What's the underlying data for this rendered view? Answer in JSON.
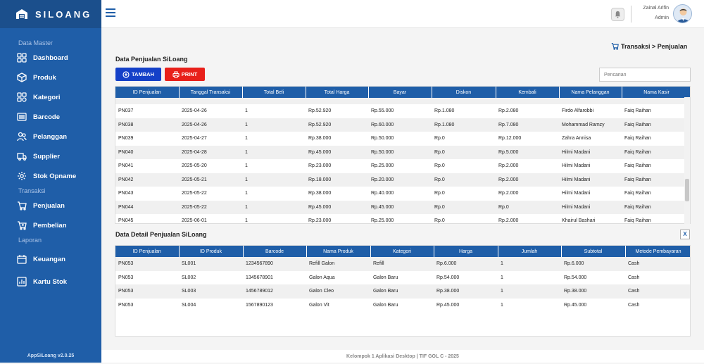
{
  "app": {
    "brand": "SILOANG",
    "version": "AppSiLoang v2.0.25"
  },
  "sidebar": {
    "sections": [
      "Data Master",
      "Transaksi",
      "Laporan"
    ],
    "items": [
      {
        "label": "Dashboard",
        "icon": "dashboard-icon"
      },
      {
        "label": "Produk",
        "icon": "box-icon"
      },
      {
        "label": "Kategori",
        "icon": "category-icon"
      },
      {
        "label": "Barcode",
        "icon": "barcode-icon"
      },
      {
        "label": "Pelanggan",
        "icon": "users-icon"
      },
      {
        "label": "Supplier",
        "icon": "truck-icon"
      },
      {
        "label": "Stok Opname",
        "icon": "gear-icon"
      },
      {
        "label": "Penjualan",
        "icon": "cart-icon"
      },
      {
        "label": "Pembelian",
        "icon": "cart-plus-icon"
      },
      {
        "label": "Keuangan",
        "icon": "calendar-icon"
      },
      {
        "label": "Kartu Stok",
        "icon": "chart-icon"
      }
    ]
  },
  "user": {
    "name": "Zainal Arifin",
    "role": "Admin"
  },
  "breadcrumb": "Transaksi > Penjualan",
  "sales": {
    "title": "Data Penjualan SiLoang",
    "add_label": "TAMBAH",
    "print_label": "PRINT",
    "search_placeholder": "Pencarian",
    "columns": [
      "ID Penjualan",
      "Tanggal Transaksi",
      "Total Beli",
      "Total Harga",
      "Bayar",
      "Diskon",
      "Kembali",
      "Nama Pelanggan",
      "Nama Kasir"
    ],
    "rows": [
      [
        "",
        "",
        "",
        "",
        "",
        "",
        "",
        "",
        ""
      ],
      [
        "PN037",
        "2025-04-26",
        "1",
        "Rp.52.920",
        "Rp.55.000",
        "Rp.1.080",
        "Rp.2.080",
        "Firdo Alfarobbi",
        "Faiq Raihan"
      ],
      [
        "PN038",
        "2025-04-26",
        "1",
        "Rp.52.920",
        "Rp.60.000",
        "Rp.1.080",
        "Rp.7.080",
        "Mohammad Ramzy",
        "Faiq Raihan"
      ],
      [
        "PN039",
        "2025-04-27",
        "1",
        "Rp.38.000",
        "Rp.50.000",
        "Rp.0",
        "Rp.12.000",
        "Zahra Annisa",
        "Faiq Raihan"
      ],
      [
        "PN040",
        "2025-04-28",
        "1",
        "Rp.45.000",
        "Rp.50.000",
        "Rp.0",
        "Rp.5.000",
        "Hilmi Madani",
        "Faiq Raihan"
      ],
      [
        "PN041",
        "2025-05-20",
        "1",
        "Rp.23.000",
        "Rp.25.000",
        "Rp.0",
        "Rp.2.000",
        "Hilmi Madani",
        "Faiq Raihan"
      ],
      [
        "PN042",
        "2025-05-21",
        "1",
        "Rp.18.000",
        "Rp.20.000",
        "Rp.0",
        "Rp.2.000",
        "Hilmi Madani",
        "Faiq Raihan"
      ],
      [
        "PN043",
        "2025-05-22",
        "1",
        "Rp.38.000",
        "Rp.40.000",
        "Rp.0",
        "Rp.2.000",
        "Hilmi Madani",
        "Faiq Raihan"
      ],
      [
        "PN044",
        "2025-05-22",
        "1",
        "Rp.45.000",
        "Rp.45.000",
        "Rp.0",
        "Rp.0",
        "Hilmi Madani",
        "Faiq Raihan"
      ],
      [
        "PN045",
        "2025-06-01",
        "1",
        "Rp.23.000",
        "Rp.25.000",
        "Rp.0",
        "Rp.2.000",
        "Khairul Bashari",
        "Faiq Raihan"
      ]
    ]
  },
  "detail": {
    "title": "Data Detail Penjualan SiLoang",
    "close_label": "X",
    "columns": [
      "ID Penjualan",
      "ID Produk",
      "Barcode",
      "Nama Produk",
      "Kategori",
      "Harga",
      "Jumlah",
      "Subtotal",
      "Metode Pembayaran"
    ],
    "rows": [
      [
        "PN053",
        "SL001",
        "1234567890",
        "Refill Galon",
        "Refill",
        "Rp.6.000",
        "1",
        "Rp.6.000",
        "Cash"
      ],
      [
        "PN053",
        "SL002",
        "1345678901",
        "Galon Aqua",
        "Galon Baru",
        "Rp.54.000",
        "1",
        "Rp.54.000",
        "Cash"
      ],
      [
        "PN053",
        "SL003",
        "1456789012",
        "Galon Cleo",
        "Galon Baru",
        "Rp.38.000",
        "1",
        "Rp.38.000",
        "Cash"
      ],
      [
        "PN053",
        "SL004",
        "1567890123",
        "Galon Vit",
        "Galon Baru",
        "Rp.45.000",
        "1",
        "Rp.45.000",
        "Cash"
      ]
    ]
  },
  "footer": "Kelompok 1 Aplikasi Desktop | TIF GOL C - 2025",
  "colors": {
    "primary": "#1f5ea8",
    "add_button": "#1440c8",
    "print_button": "#e8201a"
  }
}
